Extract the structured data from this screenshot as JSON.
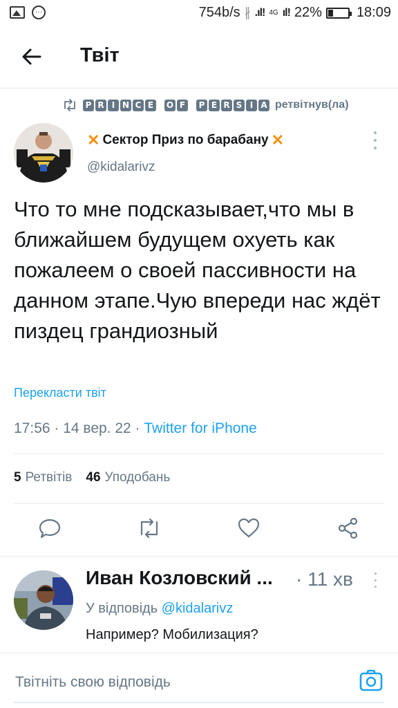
{
  "status_bar": {
    "speed": "754b/s",
    "network": "4G",
    "battery": "22%",
    "time": "18:09"
  },
  "header": {
    "title": "Твіт"
  },
  "retweet": {
    "retweeter_letters_1": [
      "P",
      "R",
      "I",
      "N",
      "C",
      "E"
    ],
    "retweeter_letters_2": [
      "O",
      "F"
    ],
    "retweeter_letters_3": [
      "P",
      "E",
      "R",
      "S",
      "I",
      "A"
    ],
    "suffix": "ретвітнув(ла)"
  },
  "tweet": {
    "author_name": "Сектор Приз по барабану",
    "author_handle": "@kidalarivz",
    "text": "Что то мне подсказывает,что мы в ближайшем будущем охуеть как пожалеем о своей пассивности на данном этапе.Чую впереди нас ждёт пиздец грандиозный",
    "translate_label": "Перекласти твіт",
    "timestamp": "17:56 · 14 вер. 22 · ",
    "source": "Twitter for iPhone",
    "retweets_count": "5",
    "retweets_label": "Ретвітів",
    "likes_count": "46",
    "likes_label": "Уподобань"
  },
  "reply": {
    "author_name": "Иван Козловский ...",
    "time": "· 11 хв",
    "reply_to_prefix": "У відповідь ",
    "reply_to_handle": "@kidalarivz",
    "text": "Например? Мобилизация?"
  },
  "compose": {
    "placeholder": "Твітніть свою відповідь"
  },
  "colors": {
    "accent": "#1da1f2",
    "secondary_text": "#657786",
    "primary_text": "#14171a",
    "divider": "#e6ecf0",
    "emoji_cross": "#f4900c"
  },
  "icons": {
    "back": "arrow-left-icon",
    "retweet_context": "retweet-icon",
    "more": "more-vertical-icon",
    "reply": "comment-icon",
    "retweet": "retweet-icon",
    "like": "heart-icon",
    "share": "share-icon",
    "camera": "camera-icon"
  }
}
